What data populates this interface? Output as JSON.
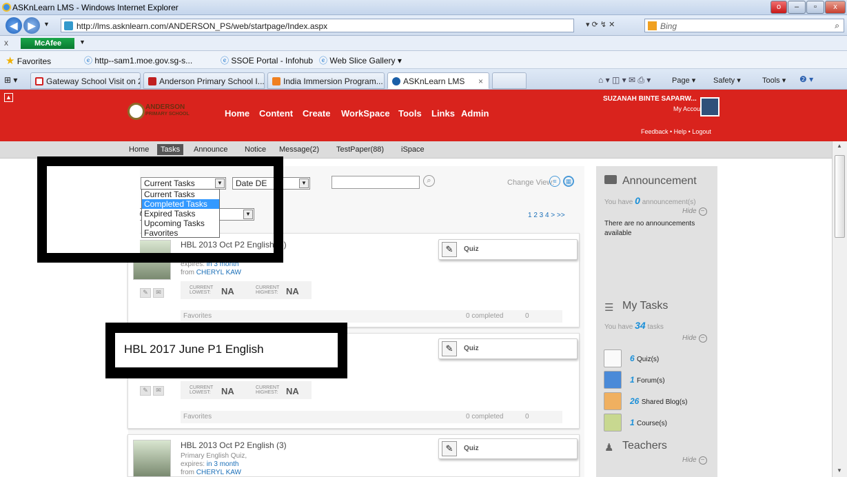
{
  "window": {
    "title": "ASKnLearn LMS - Windows Internet Explorer"
  },
  "address": {
    "url": "http://lms.asknlearn.com/ANDERSON_PS/web/startpage/Index.aspx"
  },
  "search": {
    "placeholder": "Bing"
  },
  "mcafee": {
    "label": "McAfee"
  },
  "favorites_bar": {
    "favorites_label": "Favorites",
    "items": [
      "http--sam1.moe.gov.sg-s...",
      "SSOE Portal - Infohub",
      "Web Slice Gallery"
    ]
  },
  "browser_tabs": [
    "Gateway School Visit on 2 ...",
    "Anderson Primary School I...",
    "India Immersion Program...",
    "ASKnLearn LMS"
  ],
  "command_bar": [
    "Page",
    "Safety",
    "Tools"
  ],
  "school": {
    "name": "ANDERSON",
    "subname": "PRIMARY SCHOOL"
  },
  "top_nav": [
    "Home",
    "Content",
    "Create",
    "WorkSpace",
    "Tools",
    "Links",
    "Admin"
  ],
  "user": {
    "name": "SUZANAH BINTE SAPARW...",
    "account": "My Account",
    "links": "Feedback  •  Help  •  Logout"
  },
  "sub_nav": [
    "Home",
    "Tasks",
    "Announce",
    "Notice",
    "Message(2)",
    "TestPaper(88)",
    "iSpace"
  ],
  "filters": {
    "task_filter_value": "Current Tasks",
    "task_filter_options": [
      "Current Tasks",
      "Completed Tasks",
      "Expired Tasks",
      "Upcoming Tasks",
      "Favorites"
    ],
    "date_filter_value": "Date DE",
    "second_select_value": "A",
    "change_view_label": "Change View:",
    "pagination": "1 2 3 4 > >>"
  },
  "tasks": [
    {
      "title": "HBL 2013 Oct P2 English (3)",
      "subtitle": "",
      "expires_label": "expires:",
      "expires": "in 3 month",
      "from_label": "from",
      "from": "CHERYL KAW",
      "type": "Quiz",
      "current_lowest_label": "CURRENT LOWEST:",
      "current_lowest": "NA",
      "current_highest_label": "CURRENT HIGHEST:",
      "current_highest": "NA",
      "favorites": "Favorites",
      "completed": "0 completed",
      "comments": "0"
    },
    {
      "title": "HBL 2017 June P1 English",
      "type": "Quiz",
      "current_lowest_label": "CURRENT LOWEST:",
      "current_lowest": "NA",
      "current_highest_label": "CURRENT HIGHEST:",
      "current_highest": "NA",
      "favorites": "Favorites",
      "completed": "0 completed",
      "comments": "0"
    },
    {
      "title": "HBL 2013 Oct P2 English (3)",
      "subtitle": "Primary English Quiz,",
      "expires_label": "expires:",
      "expires": "in 3 month",
      "from_label": "from",
      "from": "CHERYL KAW",
      "type": "Quiz"
    }
  ],
  "sidebar": {
    "announcement": {
      "title": "Announcement",
      "text_pre": "You have",
      "count": "0",
      "text_post": "announcement(s)",
      "hide": "Hide",
      "empty": "There are no announcements available"
    },
    "my_tasks": {
      "title": "My Tasks",
      "text_pre": "You have",
      "count": "34",
      "text_post": "tasks",
      "hide": "Hide",
      "items": [
        {
          "count": "6",
          "label": "Quiz(s)"
        },
        {
          "count": "1",
          "label": "Forum(s)"
        },
        {
          "count": "26",
          "label": "Shared Blog(s)"
        },
        {
          "count": "1",
          "label": "Course(s)"
        }
      ]
    },
    "teachers": {
      "title": "Teachers",
      "hide": "Hide"
    }
  }
}
